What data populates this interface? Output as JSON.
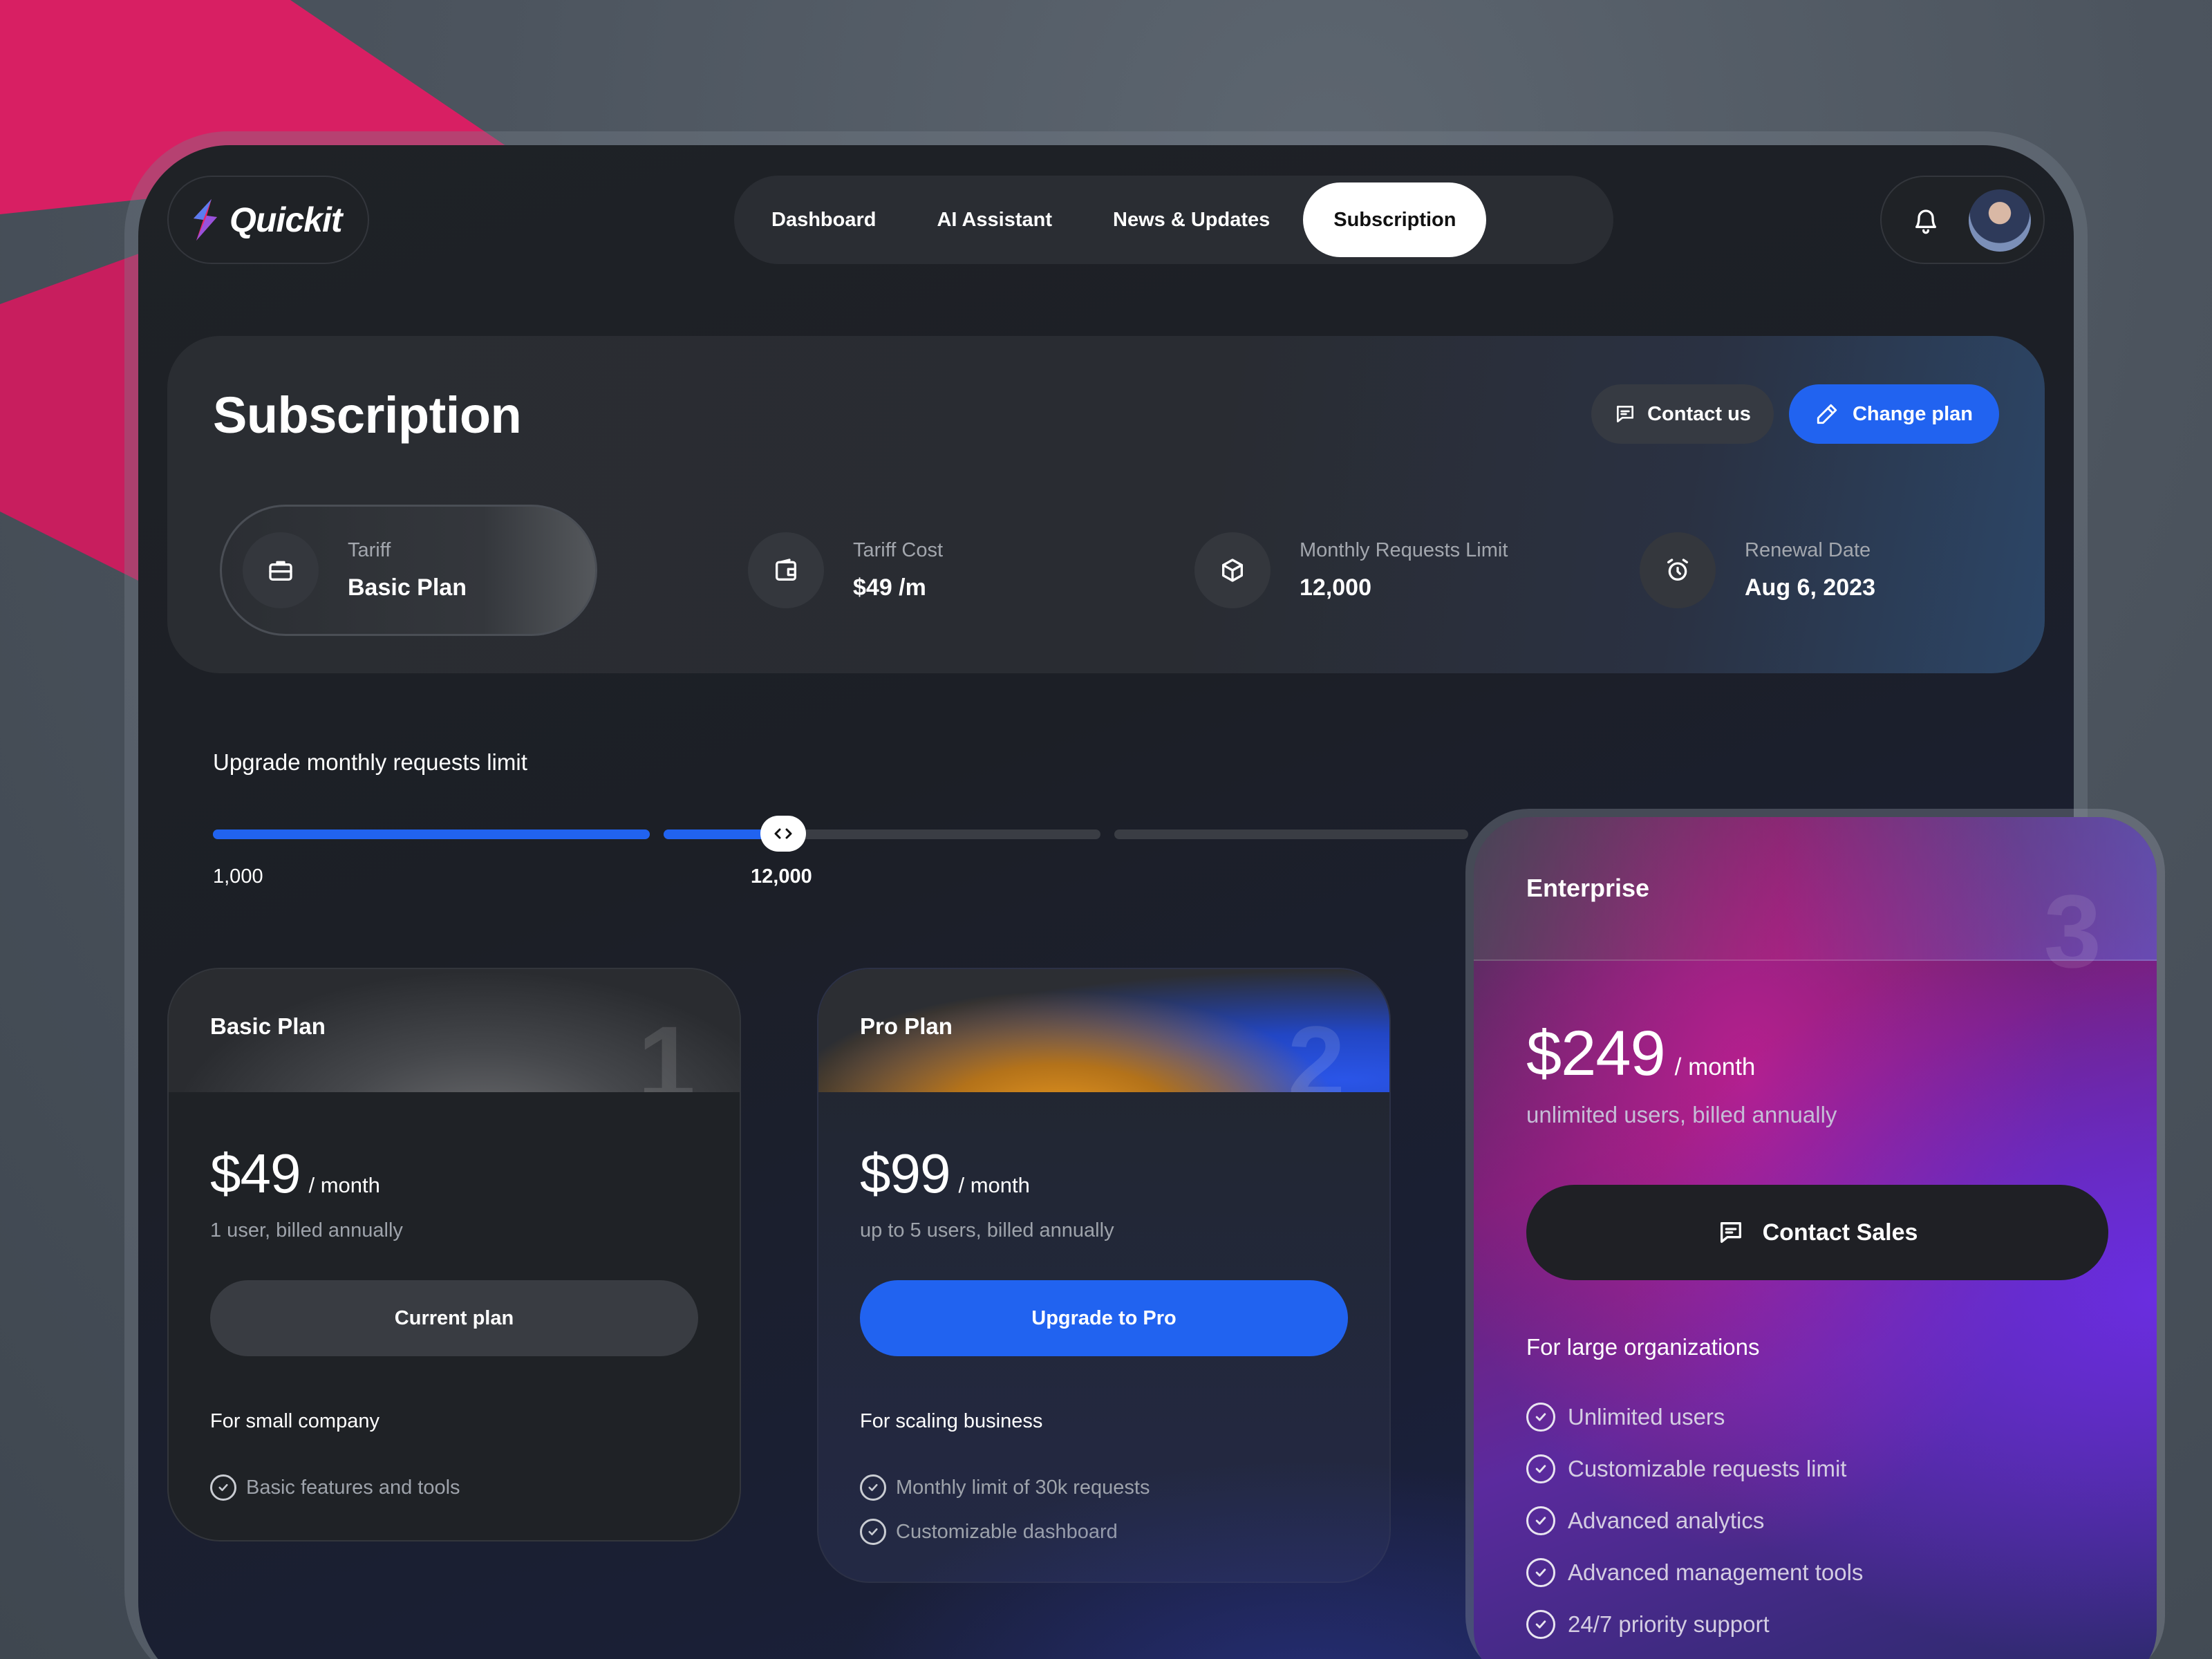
{
  "brand": {
    "name": "Quickit"
  },
  "nav": {
    "items": [
      {
        "label": "Dashboard"
      },
      {
        "label": "AI Assistant"
      },
      {
        "label": "News & Updates"
      },
      {
        "label": "Subscription"
      }
    ],
    "active": "Subscription"
  },
  "summary": {
    "title": "Subscription",
    "contact_label": "Contact us",
    "change_label": "Change plan",
    "stats": [
      {
        "label": "Tariff",
        "value": "Basic Plan",
        "icon": "briefcase-icon"
      },
      {
        "label": "Tariff Cost",
        "value": "$49 /m",
        "icon": "wallet-icon"
      },
      {
        "label": "Monthly Requests Limit",
        "value": "12,000",
        "icon": "box-icon"
      },
      {
        "label": "Renewal Date",
        "value": "Aug 6, 2023",
        "icon": "alarm-icon"
      }
    ]
  },
  "slider": {
    "title": "Upgrade monthly requests limit",
    "min_label": "1,000",
    "value_label": "12,000",
    "value": 12000
  },
  "plans": {
    "basic": {
      "name": "Basic Plan",
      "number": "1",
      "price": "$49",
      "period": "/ month",
      "sub": "1 user, billed annually",
      "button": "Current plan",
      "for": "For small company",
      "features": [
        "Basic features and tools"
      ]
    },
    "pro": {
      "name": "Pro Plan",
      "number": "2",
      "price": "$99",
      "period": "/ month",
      "sub": "up to 5 users, billed annually",
      "button": "Upgrade to Pro",
      "for": "For scaling business",
      "features": [
        "Monthly limit of 30k requests",
        "Customizable dashboard"
      ]
    },
    "enterprise": {
      "name": "Enterprise",
      "number": "3",
      "price": "$249",
      "period": "/ month",
      "sub": "unlimited users, billed annually",
      "button": "Contact Sales",
      "for": "For large organizations",
      "features": [
        "Unlimited users",
        "Customizable requests limit",
        "Advanced analytics",
        "Advanced management tools",
        "24/7 priority support"
      ]
    }
  },
  "colors": {
    "accent": "#2163f0",
    "brand_pink": "#d81f63"
  }
}
